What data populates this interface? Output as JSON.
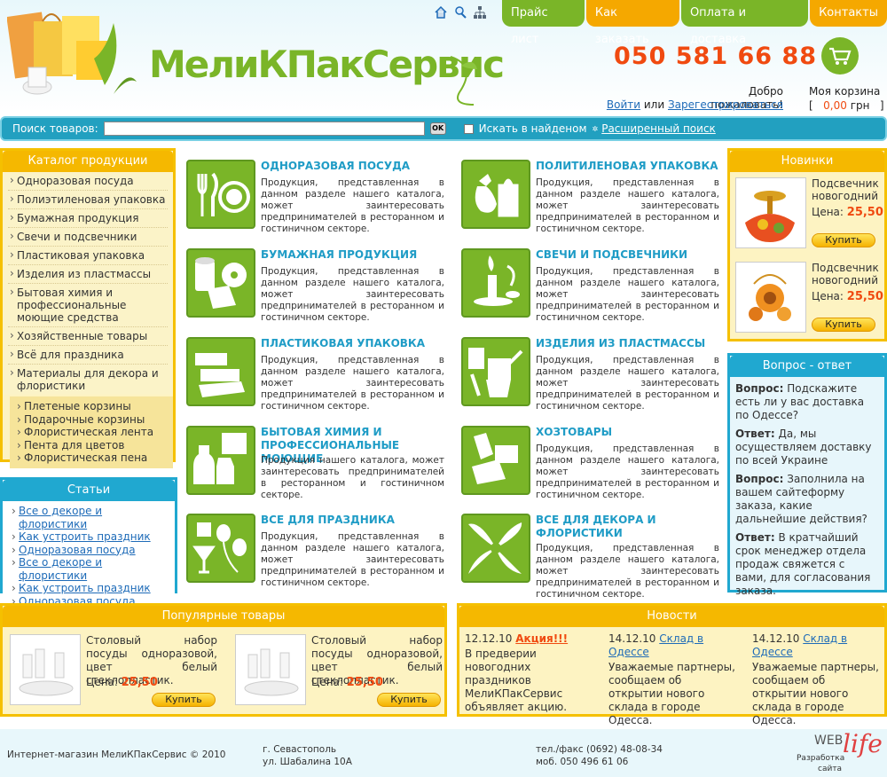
{
  "brand": {
    "logo_text": "МелиКПакСервис"
  },
  "nav": [
    "Прайс лист",
    "Как заказать",
    "Оплата и доставка",
    "Контакты"
  ],
  "phone": "050 581 66 88",
  "welcome": {
    "greeting": "Добро пожаловать!",
    "login": "Войти",
    "or": "или",
    "register": "Зарегестрироваться"
  },
  "cart": {
    "title": "Моя корзина",
    "open": "[",
    "amount": "0,00",
    "currency": "грн",
    "close": "]"
  },
  "search": {
    "label": "Поиск товаров:",
    "ok": "OK",
    "in_found": "Искать в найденом",
    "advanced": "Расширенный поиск"
  },
  "catalog": {
    "title": "Каталог продукции",
    "items": [
      "Одноразовая посуда",
      "Полиэтиленовая упаковка",
      "Бумажная продукция",
      "Свечи и подсвечники",
      "Пластиковая упаковка",
      "Изделия из пластмассы",
      "Бытовая химия и профессиональные моющие средства",
      "Хозяйственные товары",
      "Всё для праздника",
      "Материалы для декора и флористики"
    ],
    "sub": [
      "Плетеные корзины",
      "Подарочные корзины",
      "Флористическая лента",
      "Пента для цветов",
      "Флористическая пена"
    ]
  },
  "articles": {
    "title": "Статьи",
    "items": [
      "Все о декоре и флористики",
      "Как устроить праздник",
      "Одноразовая посуда",
      "Все о декоре и флористики",
      "Как устроить праздник",
      "Одноразовая посуда"
    ]
  },
  "categories": [
    {
      "title": "ОДНОРАЗОВАЯ ПОСУДА",
      "desc": "Продукция, представленная в данном разделе нашего каталога, может заинтересовать предпринимателей в ресторанном и гостиничном секторе.",
      "icon": "cutlery-icon"
    },
    {
      "title": "ПОЛИТИЛЕНОВАЯ УПАКОВКА",
      "desc": "Продукция, представленная в данном разделе нашего каталога, может заинтересовать предпринимателей в ресторанном и гостиничном секторе.",
      "icon": "bags-icon"
    },
    {
      "title": "БУМАЖНАЯ ПРОДУКЦИЯ",
      "desc": "Продукция, представленная в данном разделе нашего каталога, может заинтересовать предпринимателей в ресторанном и гостиничном секторе.",
      "icon": "paper-roll-icon"
    },
    {
      "title": "СВЕЧИ И ПОДСВЕЧНИКИ",
      "desc": "Продукция, представленная в данном разделе нашего каталога, может заинтересовать предпринимателей в ресторанном и гостиничном секторе.",
      "icon": "candle-icon"
    },
    {
      "title": "ПЛАСТИКОВАЯ УПАКОВКА",
      "desc": "Продукция, представленная в данном разделе нашего каталога, может заинтересовать предпринимателей в ресторанном и гостиничном секторе.",
      "icon": "plastic-box-icon"
    },
    {
      "title": "ИЗДЕЛИЯ ИЗ ПЛАСТМАССЫ",
      "desc": "Продукция, представленная в данном разделе нашего каталога, может заинтересовать предпринимателей в ресторанном и гостиничном секторе.",
      "icon": "watering-can-icon"
    },
    {
      "title": "БЫТОВАЯ ХИМИЯ И ПРОФЕССИОНАЛЬНЫЕ МОЮЩИЕ",
      "desc": "Продукция нашего каталога, может заинтересовать предпринимателей в ресторанном и гостиничном секторе.",
      "icon": "detergent-icon"
    },
    {
      "title": "ХОЗТОВАРЫ",
      "desc": "Продукция, представленная в данном разделе нашего каталога, может заинтересовать предпринимателей в ресторанном и гостиничном секторе.",
      "icon": "gloves-icon"
    },
    {
      "title": "ВСЕ ДЛЯ ПРАЗДНИКА",
      "desc": "Продукция, представленная в данном разделе нашего каталога, может заинтересовать предпринимателей в ресторанном и гостиничном секторе.",
      "icon": "party-icon"
    },
    {
      "title": "ВСЕ ДЛЯ ДЕКОРА И ФЛОРИСТИКИ",
      "desc": "Продукция, представленная в данном разделе нашего каталога, может заинтересовать предпринимателей в ресторанном и гостиничном секторе.",
      "icon": "floral-icon"
    }
  ],
  "novelties": {
    "title": "Новинки",
    "items": [
      {
        "name": "Подсвечник новогодний",
        "price_label": "Цена:",
        "price": "25,50",
        "buy": "Купить"
      },
      {
        "name": "Подсвечник новогодний",
        "price_label": "Цена:",
        "price": "25,50",
        "buy": "Купить"
      }
    ]
  },
  "qa": {
    "title": "Вопрос - ответ",
    "q_label": "Вопрос:",
    "a_label": "Ответ:",
    "items": [
      {
        "q": "Подскажите есть ли у вас доставка по Одессе?",
        "a": "Да, мы осуществляем доставку по всей Украине"
      },
      {
        "q": "Заполнила на вашем сайтеформу заказа, какие дальнейшие действия?",
        "a": "В кратчайший срок менеджер отдела продаж свяжется с вами, для согласования заказа."
      }
    ]
  },
  "popular": {
    "title": "Популярные товары",
    "items": [
      {
        "name": "Столовый набор посуды одноразовой, цвет белый стеклопластик.",
        "price_label": "Цена:",
        "price": "25,50",
        "buy": "Купить"
      },
      {
        "name": "Столовый набор посуды одноразовой, цвет белый стеклопластик.",
        "price_label": "Цена:",
        "price": "25,50",
        "buy": "Купить"
      }
    ]
  },
  "news": {
    "title": "Новости",
    "items": [
      {
        "date": "12.12.10",
        "title": "Акция!!!",
        "text": "В предверии новогодних праздников МелиКПакСервис объявляет акцию."
      },
      {
        "date": "14.12.10",
        "title": "Склад в Одессе",
        "text": "Уважаемые партнеры, сообщаем об открытии нового склада в городе Одесса."
      },
      {
        "date": "14.12.10",
        "title": "Склад в Одессе",
        "text": "Уважаемые партнеры, сообщаем об открытии нового склада в городе Одесса."
      }
    ]
  },
  "footer": {
    "copyright": "Интернет-магазин МелиКПакСервис © 2010",
    "city": "г. Севастополь",
    "street": "ул. Шабалина 10А",
    "tel": "тел./факс (0692) 48-08-34",
    "mob": "моб. 050 496 61 06",
    "dev_web": "WEB",
    "dev_label1": "Разработка",
    "dev_label2": "сайта",
    "dev_life": "life"
  },
  "colors": {
    "green": "#7ab528",
    "orange": "#f5b800",
    "blue": "#20a8d0",
    "price": "#f04a10"
  }
}
